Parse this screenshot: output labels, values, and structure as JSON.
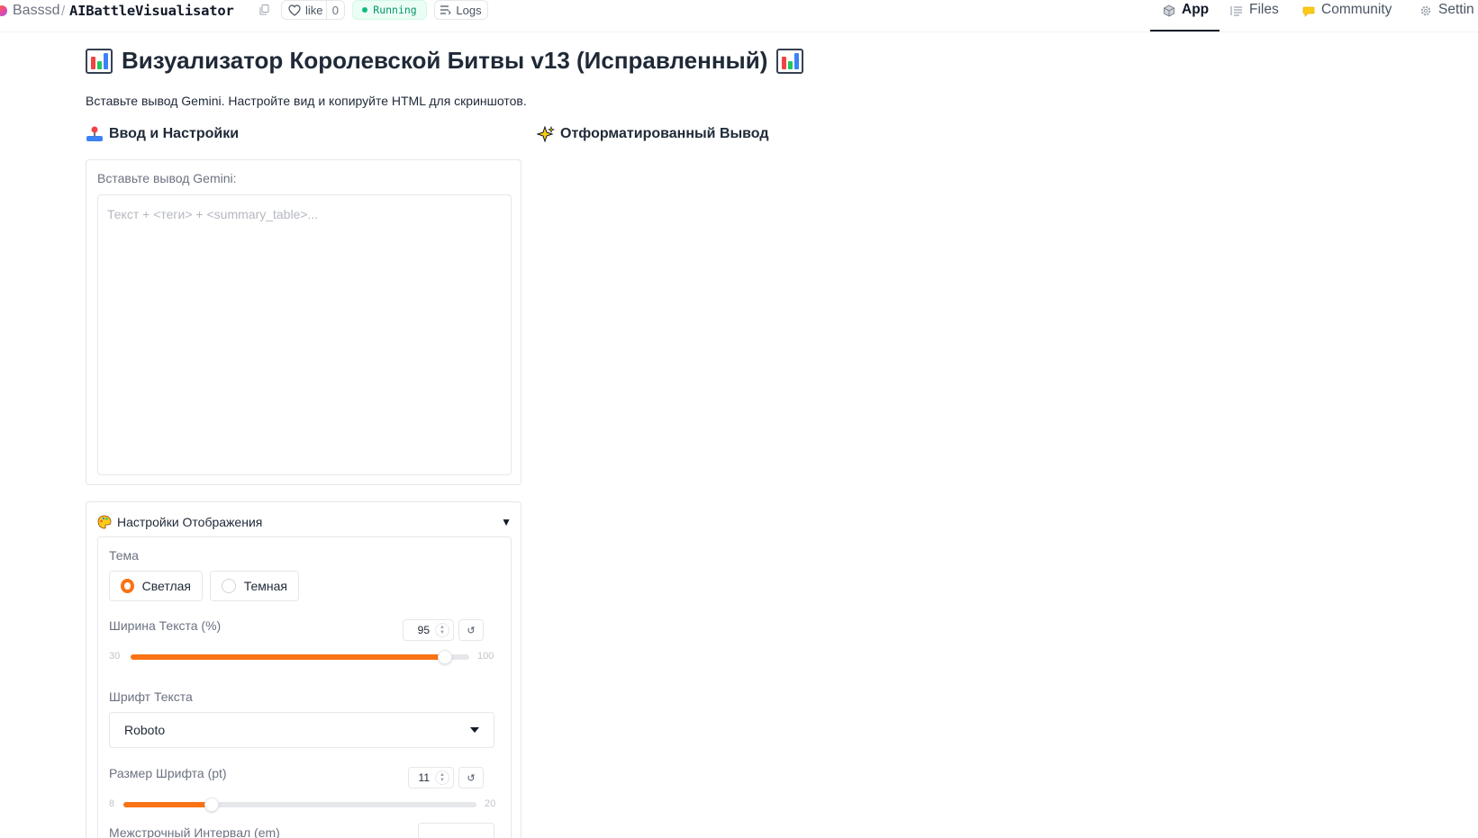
{
  "header": {
    "owner": "Basssd",
    "separator": "/",
    "repo": "AIBattleVisualisator",
    "like_label": "like",
    "like_count": "0",
    "status": "Running",
    "logs_label": "Logs",
    "tabs": [
      {
        "label": "App",
        "icon": "cube-icon",
        "active": true
      },
      {
        "label": "Files",
        "icon": "files-icon",
        "active": false
      },
      {
        "label": "Community",
        "icon": "community-icon",
        "active": false
      },
      {
        "label": "Settin",
        "icon": "gear-icon",
        "active": false
      }
    ]
  },
  "main": {
    "title": "Визуализатор Королевской Битвы v13 (Исправленный)",
    "subtitle": "Вставьте вывод Gemini. Настройте вид и копируйте HTML для скриншотов.",
    "input_section_title": "Ввод и Настройки",
    "output_section_title": "Отформатированный Вывод",
    "input": {
      "label": "Вставьте вывод Gemini:",
      "placeholder": "Текст + <теги> + <summary_table>...",
      "value": ""
    },
    "settings": {
      "title": "Настройки Отображения",
      "arrow": "▼",
      "theme": {
        "label": "Тема",
        "options": [
          "Светлая",
          "Темная"
        ],
        "selected": "Светлая"
      },
      "text_width": {
        "label": "Ширина Текста (%)",
        "value": "95",
        "min": "30",
        "max": "100",
        "fraction": 0.928
      },
      "font": {
        "label": "Шрифт Текста",
        "selected": "Roboto"
      },
      "font_size": {
        "label": "Размер Шрифта (pt)",
        "value": "11",
        "min": "8",
        "max": "20",
        "fraction": 0.25
      },
      "cut_off_label": "Межстрочный Интервал (em)"
    }
  },
  "colors": {
    "accent": "#f97316",
    "status_green": "#059669",
    "text": "#1f2937",
    "muted": "#6b7280"
  },
  "icons": [
    "copy-icon",
    "heart-icon",
    "logs-icon",
    "cube-icon",
    "files-icon",
    "community-icon",
    "gear-icon",
    "bar-chart-icon",
    "joystick-icon",
    "sparkles-icon",
    "palette-icon"
  ]
}
